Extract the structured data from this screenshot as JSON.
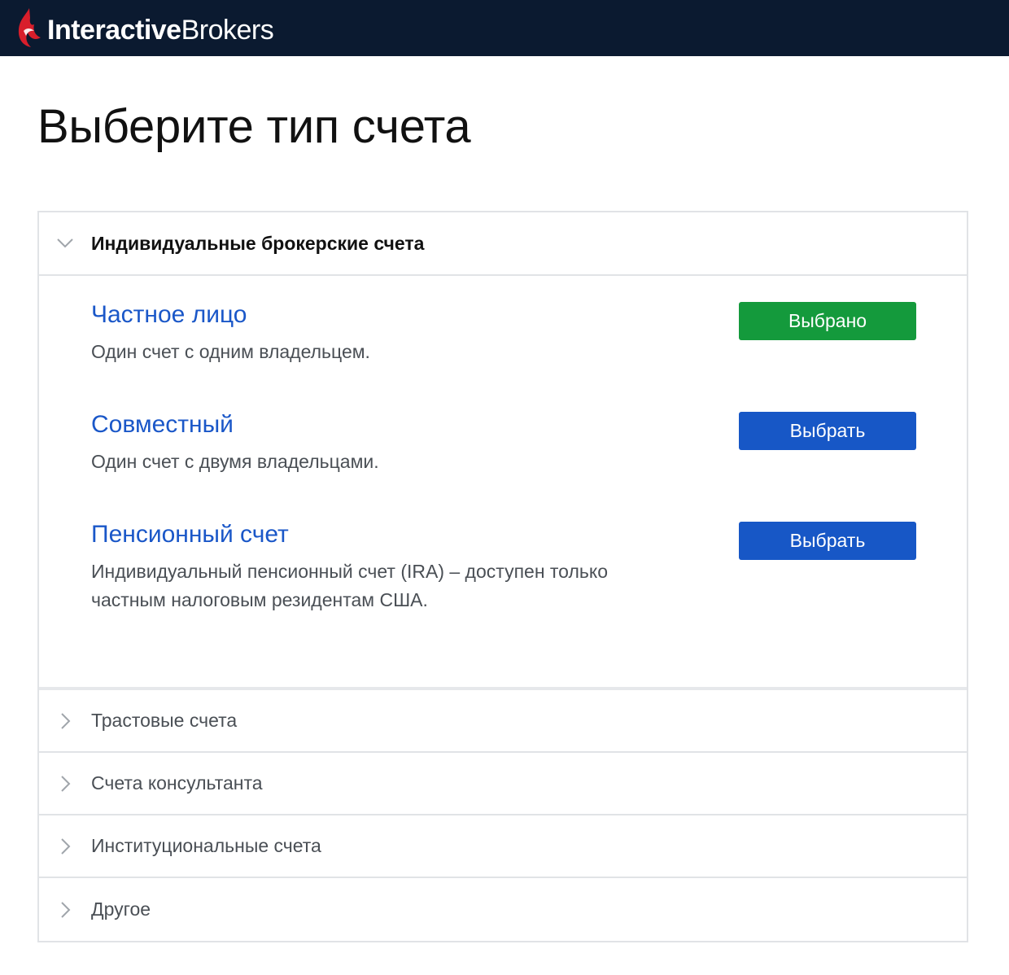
{
  "header": {
    "brand_strong": "Interactive",
    "brand_light": "Brokers",
    "background": "#0b1a30",
    "logo_accent": "#d81e2b"
  },
  "page": {
    "title": "Выберите тип счета"
  },
  "accordion": {
    "expanded": {
      "title": "Индивидуальные брокерские счета",
      "icon": "chevron-down-icon",
      "options": [
        {
          "title": "Частное лицо",
          "description": "Один счет с одним владельцем.",
          "button": "Выбрано",
          "state": "selected",
          "button_color": "#149a3c"
        },
        {
          "title": "Совместный",
          "description": "Один счет с двумя владельцами.",
          "button": "Выбрать",
          "state": "available",
          "button_color": "#1757c6"
        },
        {
          "title": "Пенсионный счет",
          "description": "Индивидуальный пенсионный счет (IRA) – доступен только частным налоговым резидентам США.",
          "button": "Выбрать",
          "state": "available",
          "button_color": "#1757c6"
        }
      ]
    },
    "collapsed": [
      {
        "label": "Трастовые счета",
        "icon": "chevron-right-icon"
      },
      {
        "label": "Счета консультанта",
        "icon": "chevron-right-icon"
      },
      {
        "label": "Институциональные счета",
        "icon": "chevron-right-icon"
      },
      {
        "label": "Другое",
        "icon": "chevron-right-icon"
      }
    ]
  },
  "colors": {
    "link_blue": "#1a57c8",
    "border": "#e1e3e6",
    "muted_text": "#4a4f55"
  }
}
